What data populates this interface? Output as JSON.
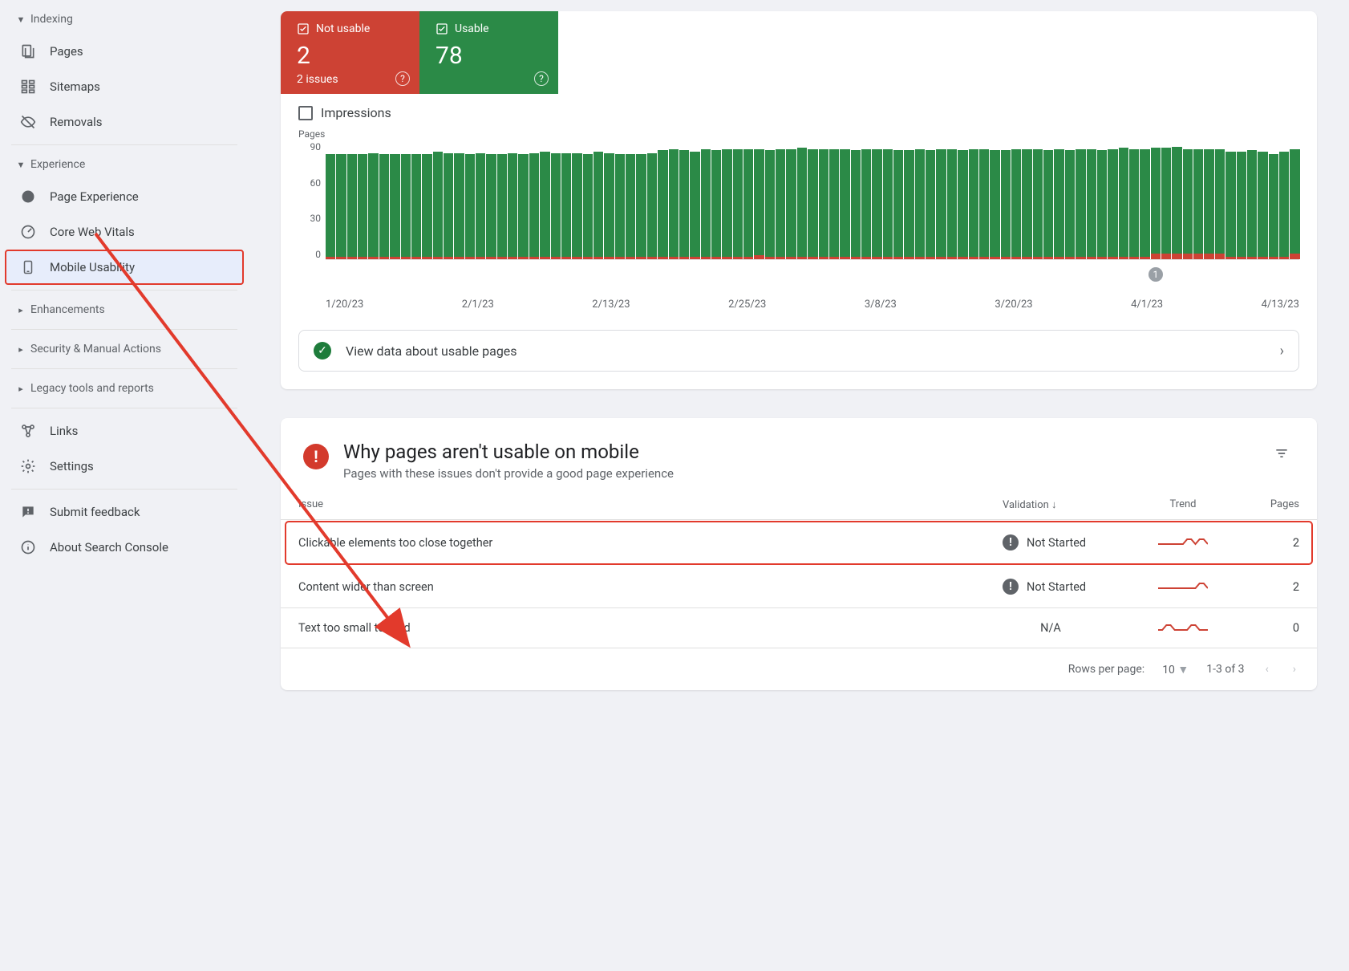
{
  "sidebar": {
    "sections": [
      {
        "label": "Indexing",
        "items": [
          {
            "label": "Pages",
            "icon": "pages-icon"
          },
          {
            "label": "Sitemaps",
            "icon": "sitemaps-icon"
          },
          {
            "label": "Removals",
            "icon": "removals-icon"
          }
        ]
      },
      {
        "label": "Experience",
        "items": [
          {
            "label": "Page Experience",
            "icon": "page-experience-icon"
          },
          {
            "label": "Core Web Vitals",
            "icon": "core-web-vitals-icon"
          },
          {
            "label": "Mobile Usability",
            "icon": "mobile-usability-icon"
          }
        ]
      },
      {
        "label": "Enhancements"
      },
      {
        "label": "Security & Manual Actions"
      },
      {
        "label": "Legacy tools and reports"
      }
    ],
    "footer": [
      {
        "label": "Links",
        "icon": "links-icon"
      },
      {
        "label": "Settings",
        "icon": "settings-icon"
      },
      {
        "label": "Submit feedback",
        "icon": "feedback-icon"
      },
      {
        "label": "About Search Console",
        "icon": "about-icon"
      }
    ]
  },
  "status": {
    "not_usable_label": "Not usable",
    "not_usable_count": "2",
    "not_usable_sub": "2 issues",
    "usable_label": "Usable",
    "usable_count": "78"
  },
  "impressions_label": "Impressions",
  "chart_data": {
    "type": "bar",
    "title": "Pages",
    "ylabel": "Pages",
    "ylim": [
      0,
      90
    ],
    "y_ticks": [
      90,
      60,
      30,
      0
    ],
    "x_ticks": [
      "1/20/23",
      "2/1/23",
      "2/13/23",
      "2/25/23",
      "3/8/23",
      "3/20/23",
      "4/1/23",
      "4/13/23"
    ],
    "series": [
      {
        "name": "Usable",
        "color": "#2b8a47"
      },
      {
        "name": "Not usable",
        "color": "#cd4234"
      }
    ],
    "usable_values": [
      78,
      78,
      78,
      78,
      79,
      78,
      78,
      78,
      78,
      78,
      80,
      79,
      79,
      78,
      79,
      78,
      78,
      79,
      78,
      79,
      80,
      79,
      79,
      79,
      78,
      80,
      79,
      78,
      78,
      78,
      79,
      81,
      82,
      81,
      80,
      82,
      81,
      82,
      82,
      82,
      81,
      81,
      82,
      82,
      83,
      82,
      82,
      82,
      82,
      81,
      82,
      82,
      82,
      81,
      81,
      82,
      81,
      82,
      82,
      81,
      82,
      82,
      81,
      81,
      82,
      82,
      82,
      81,
      82,
      81,
      82,
      82,
      81,
      82,
      83,
      82,
      82,
      81,
      81,
      82,
      80,
      80,
      80,
      80,
      80,
      80,
      81,
      80,
      78,
      80,
      80
    ],
    "not_usable_values": [
      2,
      2,
      2,
      2,
      2,
      2,
      2,
      2,
      2,
      2,
      2,
      2,
      2,
      2,
      2,
      2,
      2,
      2,
      2,
      2,
      2,
      2,
      2,
      2,
      2,
      2,
      2,
      2,
      2,
      2,
      2,
      2,
      2,
      2,
      2,
      2,
      2,
      2,
      2,
      2,
      3,
      2,
      2,
      2,
      2,
      2,
      2,
      2,
      2,
      2,
      2,
      2,
      2,
      2,
      2,
      2,
      2,
      2,
      2,
      2,
      2,
      2,
      2,
      2,
      2,
      2,
      2,
      2,
      2,
      2,
      2,
      2,
      2,
      2,
      2,
      2,
      2,
      4,
      4,
      4,
      4,
      4,
      4,
      4,
      2,
      2,
      2,
      2,
      2,
      2,
      4
    ],
    "annotation": {
      "index": 77,
      "label": "1"
    }
  },
  "view_data_label": "View data about usable pages",
  "issues": {
    "title": "Why pages aren't usable on mobile",
    "subtitle": "Pages with these issues don't provide a good page experience",
    "columns": {
      "issue": "Issue",
      "validation": "Validation",
      "trend": "Trend",
      "pages": "Pages"
    },
    "rows": [
      {
        "issue": "Clickable elements too close together",
        "validation": "Not Started",
        "pages": "2",
        "trend": [
          2,
          2,
          2,
          2,
          2,
          2,
          2,
          4,
          4,
          2,
          4,
          4,
          2
        ]
      },
      {
        "issue": "Content wider than screen",
        "validation": "Not Started",
        "pages": "2",
        "trend": [
          2,
          2,
          2,
          2,
          2,
          2,
          2,
          2,
          2,
          2,
          4,
          4,
          2
        ]
      },
      {
        "issue": "Text too small to read",
        "validation": "N/A",
        "pages": "0",
        "trend": [
          2,
          2,
          4,
          4,
          2,
          2,
          2,
          2,
          4,
          4,
          2,
          2,
          2
        ]
      }
    ]
  },
  "pager": {
    "rows_label": "Rows per page:",
    "rows_value": "10",
    "range": "1-3 of 3"
  }
}
